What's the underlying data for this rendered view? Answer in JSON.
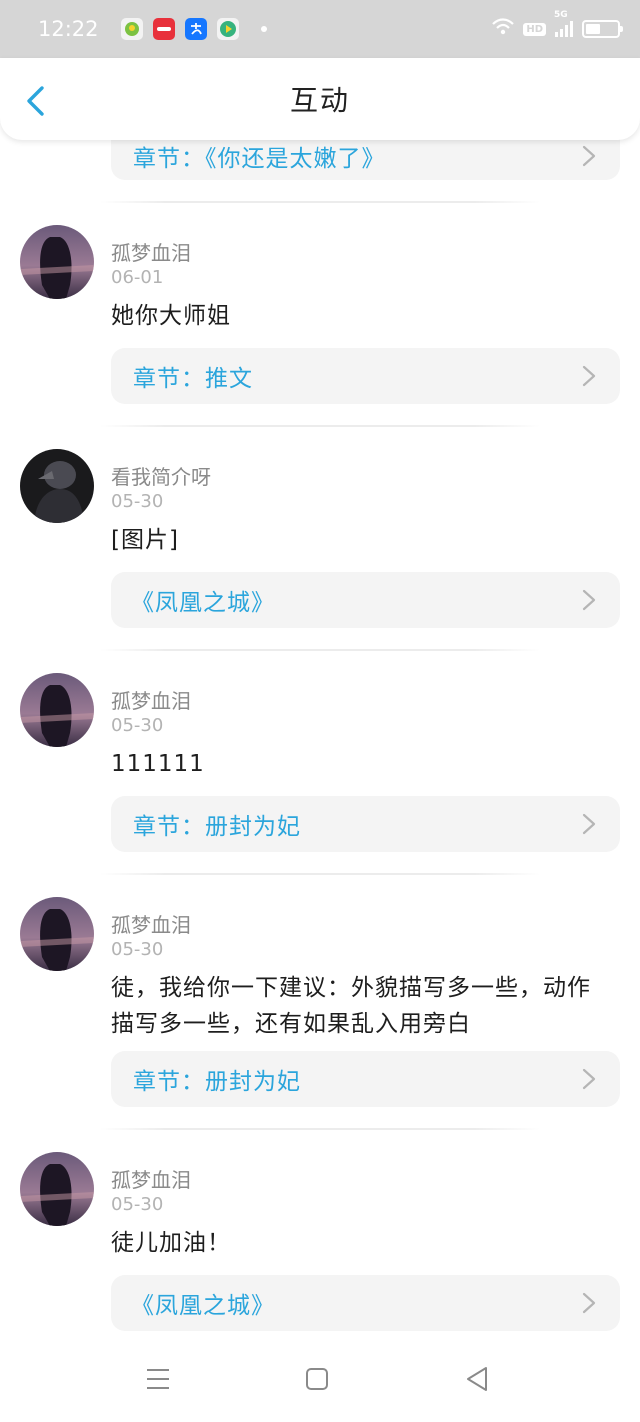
{
  "status_bar": {
    "time": "12:22",
    "apps": [
      {
        "icon": "app-icon-green",
        "color": "#7cc242"
      },
      {
        "icon": "app-icon-red",
        "color": "#e8313b"
      },
      {
        "icon": "alipay-icon",
        "color": "#1677ff"
      },
      {
        "icon": "video-app-icon",
        "color": "#36b37e"
      }
    ],
    "hd": "HD",
    "signal": "5G"
  },
  "header": {
    "title": "互动",
    "back_icon": "chevron-left-icon"
  },
  "top_card": {
    "chapter": "章节：《你还是太嫩了》"
  },
  "items": [
    {
      "username": "孤梦血泪",
      "date": "06-01",
      "comment": "她你大师姐",
      "link": "章节：推文",
      "avatar": "dark-haired-girl-avatar"
    },
    {
      "username": "看我简介呀",
      "date": "05-30",
      "comment": "[图片]",
      "link": "《凤凰之城》",
      "avatar": "dark-photo-avatar"
    },
    {
      "username": "孤梦血泪",
      "date": "05-30",
      "comment": "111111",
      "link": "章节：册封为妃",
      "avatar": "dark-haired-girl-avatar"
    },
    {
      "username": "孤梦血泪",
      "date": "05-30",
      "comment": "徒，我给你一下建议：外貌描写多一些，动作描写多一些，还有如果乱入用旁白",
      "link": "章节：册封为妃",
      "avatar": "dark-haired-girl-avatar"
    },
    {
      "username": "孤梦血泪",
      "date": "05-30",
      "comment": "徒儿加油！",
      "link": "《凤凰之城》",
      "avatar": "dark-haired-girl-avatar"
    }
  ],
  "colors": {
    "link": "#2ba5dc",
    "card_bg": "#f4f4f4",
    "status_bar_bg": "#d6d6d6"
  },
  "nav": {
    "menu_icon": "menu-icon",
    "home_icon": "square-home-icon",
    "back_icon": "triangle-back-icon"
  }
}
